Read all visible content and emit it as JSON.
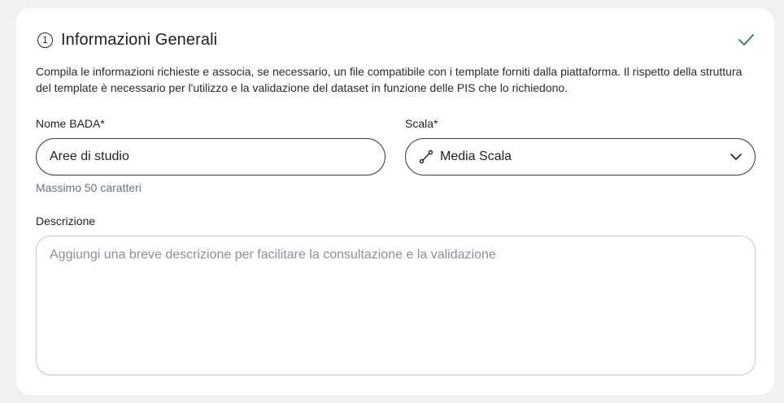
{
  "section": {
    "step_number": "1",
    "title": "Informazioni Generali",
    "status_icon": "check-icon",
    "status_color": "#2e7d4f",
    "description": "Compila le informazioni richieste e associa, se necessario, un file compatibile con i template forniti dalla piattaforma. Il rispetto della struttura del template è necessario per l'utilizzo e la validazione del dataset in funzione delle PIS che lo richiedono."
  },
  "form": {
    "name": {
      "label": "Nome BADA*",
      "value": "Aree di studio",
      "helper": "Massimo 50 caratteri"
    },
    "scale": {
      "label": "Scala*",
      "value": "Media Scala",
      "icon": "scale-ruler-icon"
    },
    "description": {
      "label": "Descrizione",
      "placeholder": "Aggiungi una breve descrizione per facilitare la consultazione e la validazione"
    }
  }
}
